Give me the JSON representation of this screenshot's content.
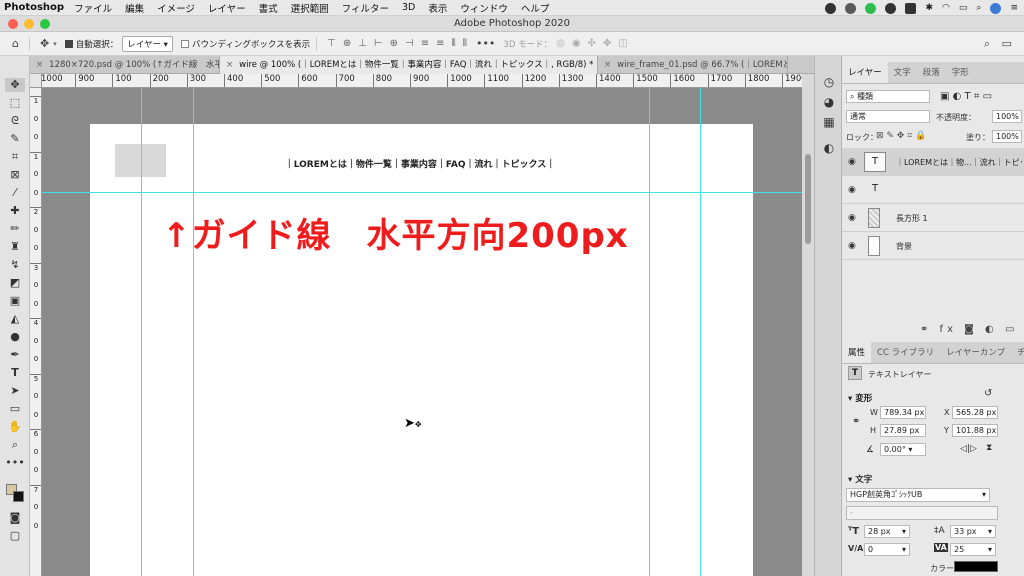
{
  "menubar": {
    "app": "Photoshop",
    "items": [
      "ファイル",
      "編集",
      "イメージ",
      "レイヤー",
      "書式",
      "選択範囲",
      "フィルター",
      "3D",
      "表示",
      "ウィンドウ",
      "ヘルプ"
    ]
  },
  "window": {
    "title": "Adobe Photoshop 2020"
  },
  "options": {
    "auto_select_label": "自動選択：",
    "auto_select_value": "レイヤー",
    "bounding_box_label": "バウンディングボックスを表示",
    "mode3d_label": "3D モード："
  },
  "tabs": [
    {
      "label": "1280×720.psd @ 100% (↑ガイド線　水平..."
    },
    {
      "label": "wire @ 100% (｜LOREMとは｜物件一覧｜事業内容｜FAQ｜流れ｜トピックス｜, RGB/8) *"
    },
    {
      "label": "wire_frame_01.psd @ 66.7% (｜LOREMと..."
    }
  ],
  "ruler": {
    "h_labels": [
      "1000",
      "900",
      "100",
      "200",
      "300",
      "400",
      "500",
      "600",
      "700",
      "800",
      "900",
      "1000",
      "1100",
      "1200",
      "1300",
      "1400",
      "1500",
      "1600",
      "1700",
      "1800",
      "1900",
      "2000"
    ],
    "v_labels": [
      "1",
      "0",
      "0",
      "1",
      "0",
      "0",
      "2",
      "0",
      "0",
      "3",
      "0",
      "0",
      "4",
      "0",
      "0",
      "5",
      "0",
      "0",
      "6",
      "0",
      "0",
      "7",
      "0",
      "0"
    ]
  },
  "canvas": {
    "nav_text": "｜LOREMとは｜物件一覧｜事業内容｜FAQ｜流れ｜トピックス｜",
    "annotation": "↑ガイド線　水平方向200px",
    "annotation_color": "#ee1c1c",
    "guide_color": "#3ee3e8"
  },
  "layers_panel": {
    "tabs": [
      "レイヤー",
      "文字",
      "段落",
      "字形"
    ],
    "filter_label": "種類",
    "blend_mode": "通常",
    "opacity_label": "不透明度：",
    "opacity_value": "100%",
    "lock_label": "ロック：",
    "fill_label": "塗り：",
    "fill_value": "100%",
    "layers": [
      {
        "name": "｜LOREMとは｜物...｜流れ｜トピックス｜",
        "thumb": "T"
      },
      {
        "name": "",
        "thumb": "T"
      },
      {
        "name": "長方形 1",
        "thumb": ""
      },
      {
        "name": "背景",
        "thumb": ""
      }
    ]
  },
  "properties_panel": {
    "tabs": [
      "属性",
      "CC ライブラリ",
      "レイヤーカンプ",
      "チャンネ"
    ],
    "layer_type": "テキストレイヤー",
    "transform_label": "変形",
    "w_label": "W",
    "w_value": "789.34 px",
    "x_label": "X",
    "x_value": "565.28 px",
    "h_label": "H",
    "h_value": "27.89 px",
    "y_label": "Y",
    "y_value": "101.88 px",
    "angle_value": "0.00°",
    "type_label": "文字",
    "font_family": "HGP創英角ｺﾞｼｯｸUB",
    "font_style": "-",
    "font_size": "28 px",
    "leading": "33 px",
    "kerning": "0",
    "tracking": "25",
    "color_label": "カラー"
  }
}
